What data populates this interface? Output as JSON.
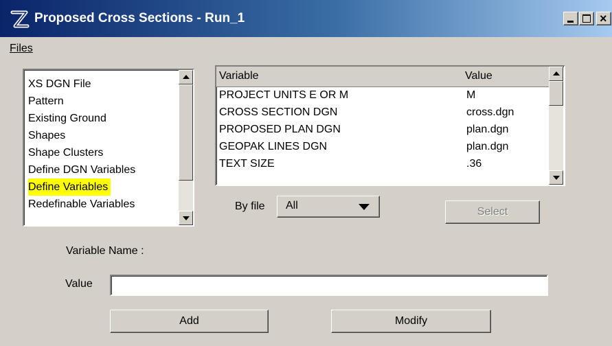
{
  "window": {
    "title": "Proposed Cross Sections - Run_1",
    "min_glyph": "_",
    "close_glyph": "×"
  },
  "menu": {
    "files_label": "Files"
  },
  "left_list": {
    "items": [
      {
        "label": "XS DGN File",
        "selected": false
      },
      {
        "label": "Pattern",
        "selected": false
      },
      {
        "label": "Existing Ground",
        "selected": false
      },
      {
        "label": "Shapes",
        "selected": false
      },
      {
        "label": "Shape Clusters",
        "selected": false
      },
      {
        "label": "Define DGN Variables",
        "selected": false
      },
      {
        "label": "Define Variables",
        "selected": true
      },
      {
        "label": "Redefinable Variables",
        "selected": false
      }
    ],
    "highlight_color": "#ffff00"
  },
  "table": {
    "headers": {
      "variable": "Variable",
      "value": "Value"
    },
    "rows": [
      {
        "variable": "PROJECT UNITS E OR M",
        "value": "M"
      },
      {
        "variable": "CROSS SECTION DGN",
        "value": "cross.dgn"
      },
      {
        "variable": "PROPOSED PLAN DGN",
        "value": "plan.dgn"
      },
      {
        "variable": "GEOPAK LINES DGN",
        "value": "plan.dgn"
      },
      {
        "variable": "TEXT SIZE",
        "value": ".36"
      }
    ]
  },
  "filter": {
    "label": "By file",
    "selected": "All"
  },
  "buttons": {
    "select": "Select",
    "add": "Add",
    "modify": "Modify"
  },
  "form": {
    "variable_name_label": "Variable Name :",
    "variable_name_value": "",
    "value_label": "Value",
    "value_input": ""
  },
  "colors": {
    "titlebar_start": "#0a246a",
    "titlebar_end": "#a6caf0",
    "dialog_bg": "#d4d0c8"
  }
}
